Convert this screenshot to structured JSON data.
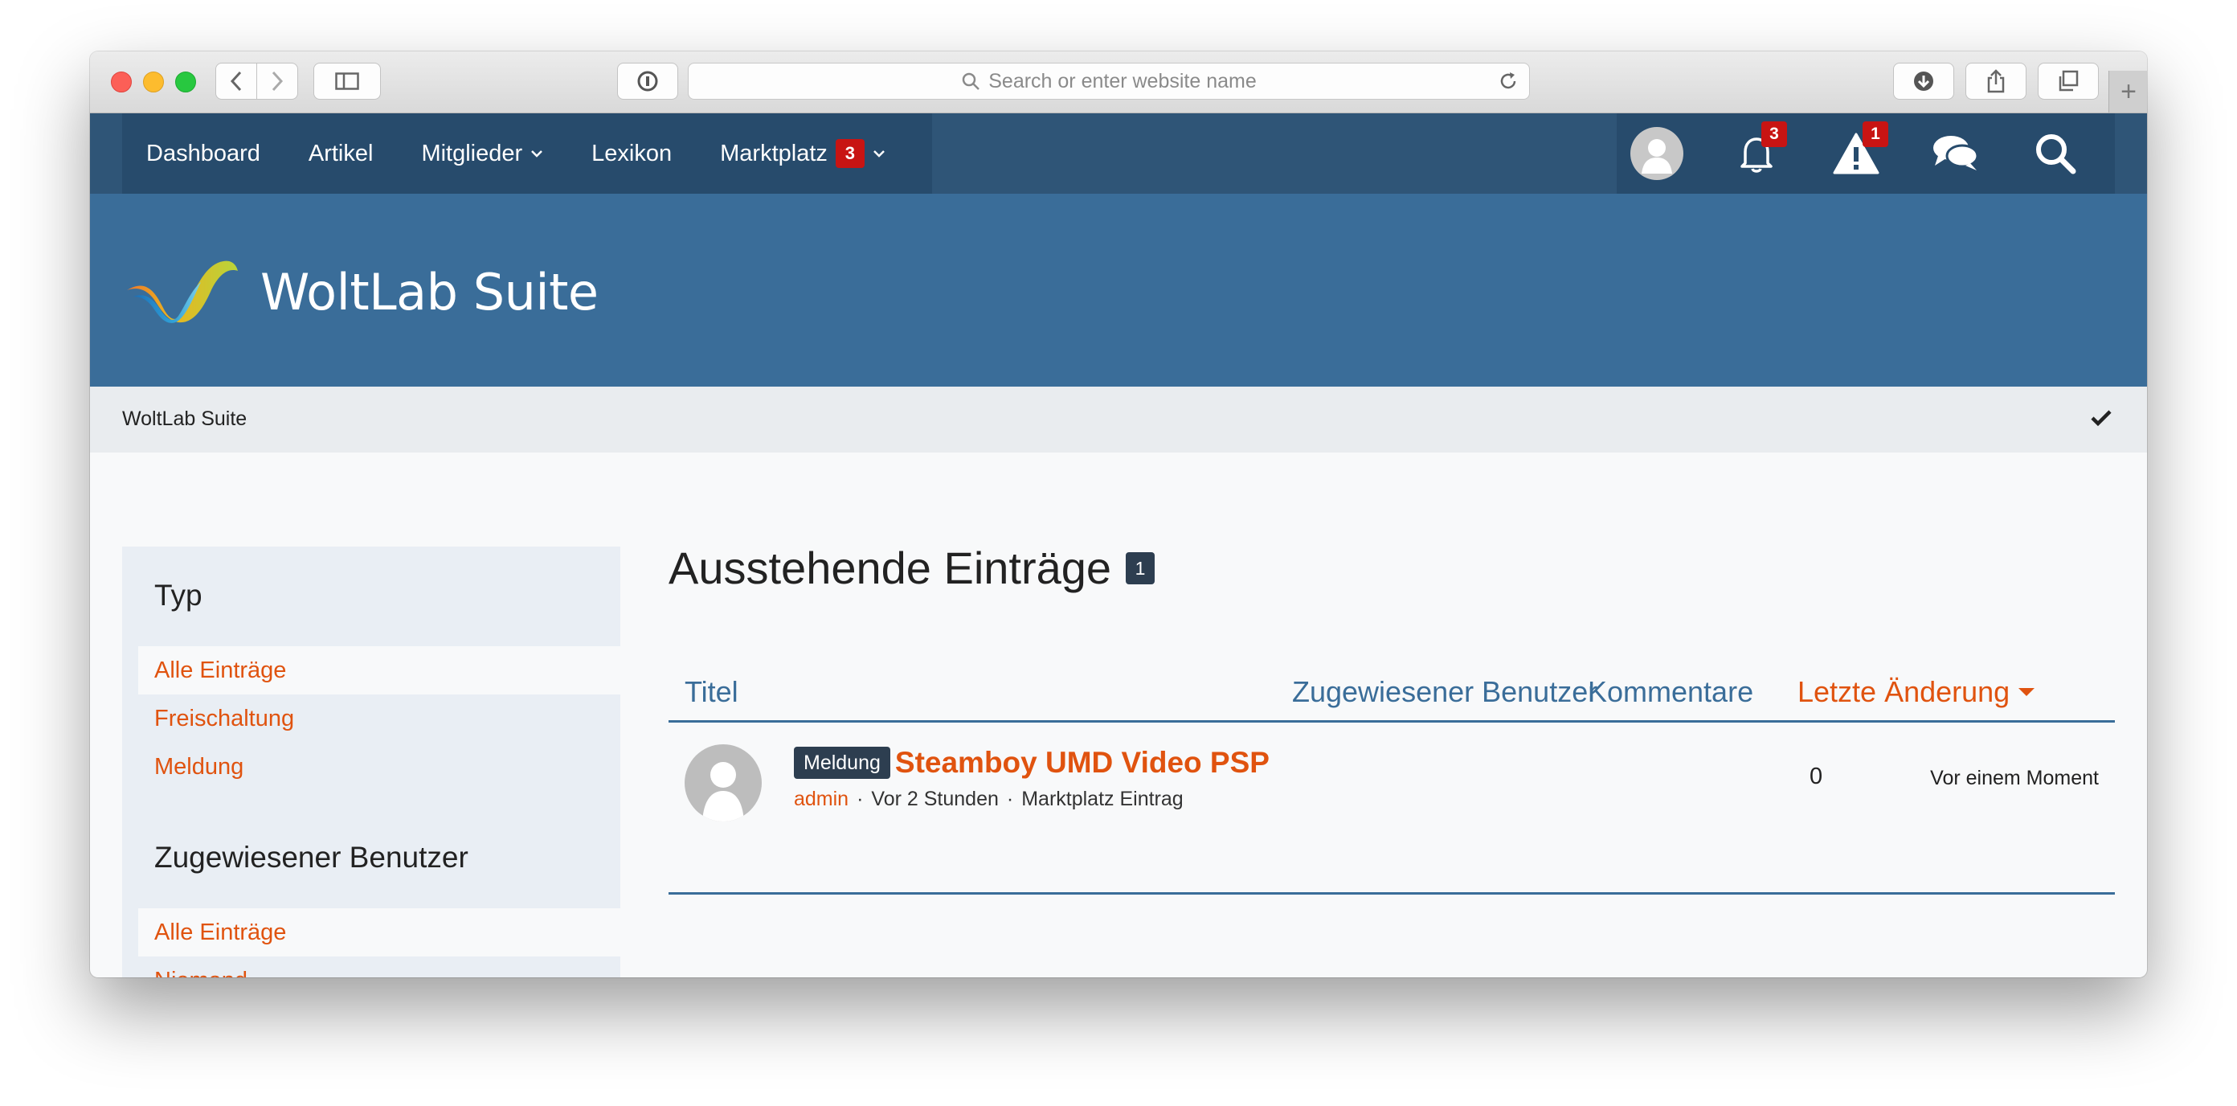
{
  "browser": {
    "url_placeholder": "Search or enter website name"
  },
  "nav": {
    "items": [
      {
        "label": "Dashboard"
      },
      {
        "label": "Artikel"
      },
      {
        "label": "Mitglieder"
      },
      {
        "label": "Lexikon"
      },
      {
        "label": "Marktplatz",
        "badge": "3"
      }
    ],
    "notifications_count": "3",
    "moderation_count": "1"
  },
  "header": {
    "logo_text": "WoltLab Suite"
  },
  "breadcrumb": {
    "label": "WoltLab Suite"
  },
  "sidebar": {
    "section1": {
      "title": "Typ",
      "items": [
        {
          "label": "Alle Einträge",
          "active": true
        },
        {
          "label": "Freischaltung"
        },
        {
          "label": "Meldung"
        }
      ]
    },
    "section2": {
      "title": "Zugewiesener Benutzer",
      "items": [
        {
          "label": "Alle Einträge",
          "active": true
        },
        {
          "label": "Niemand"
        }
      ]
    }
  },
  "main": {
    "title": "Ausstehende Einträge",
    "count": "1",
    "columns": {
      "title": "Titel",
      "assigned": "Zugewiesener Benutzer",
      "comments": "Kommentare",
      "last_change": "Letzte Änderung"
    },
    "rows": [
      {
        "label": "Meldung",
        "title": "Steamboy UMD Video PSP",
        "author": "admin",
        "time": "Vor 2 Stunden",
        "type": "Marktplatz Eintrag",
        "comments": "0",
        "last_change": "Vor einem Moment"
      }
    ]
  },
  "colors": {
    "nav_bg": "#2f5577",
    "header_bg": "#3a6d99",
    "accent": "#e0530f",
    "badge": "#c81413"
  }
}
